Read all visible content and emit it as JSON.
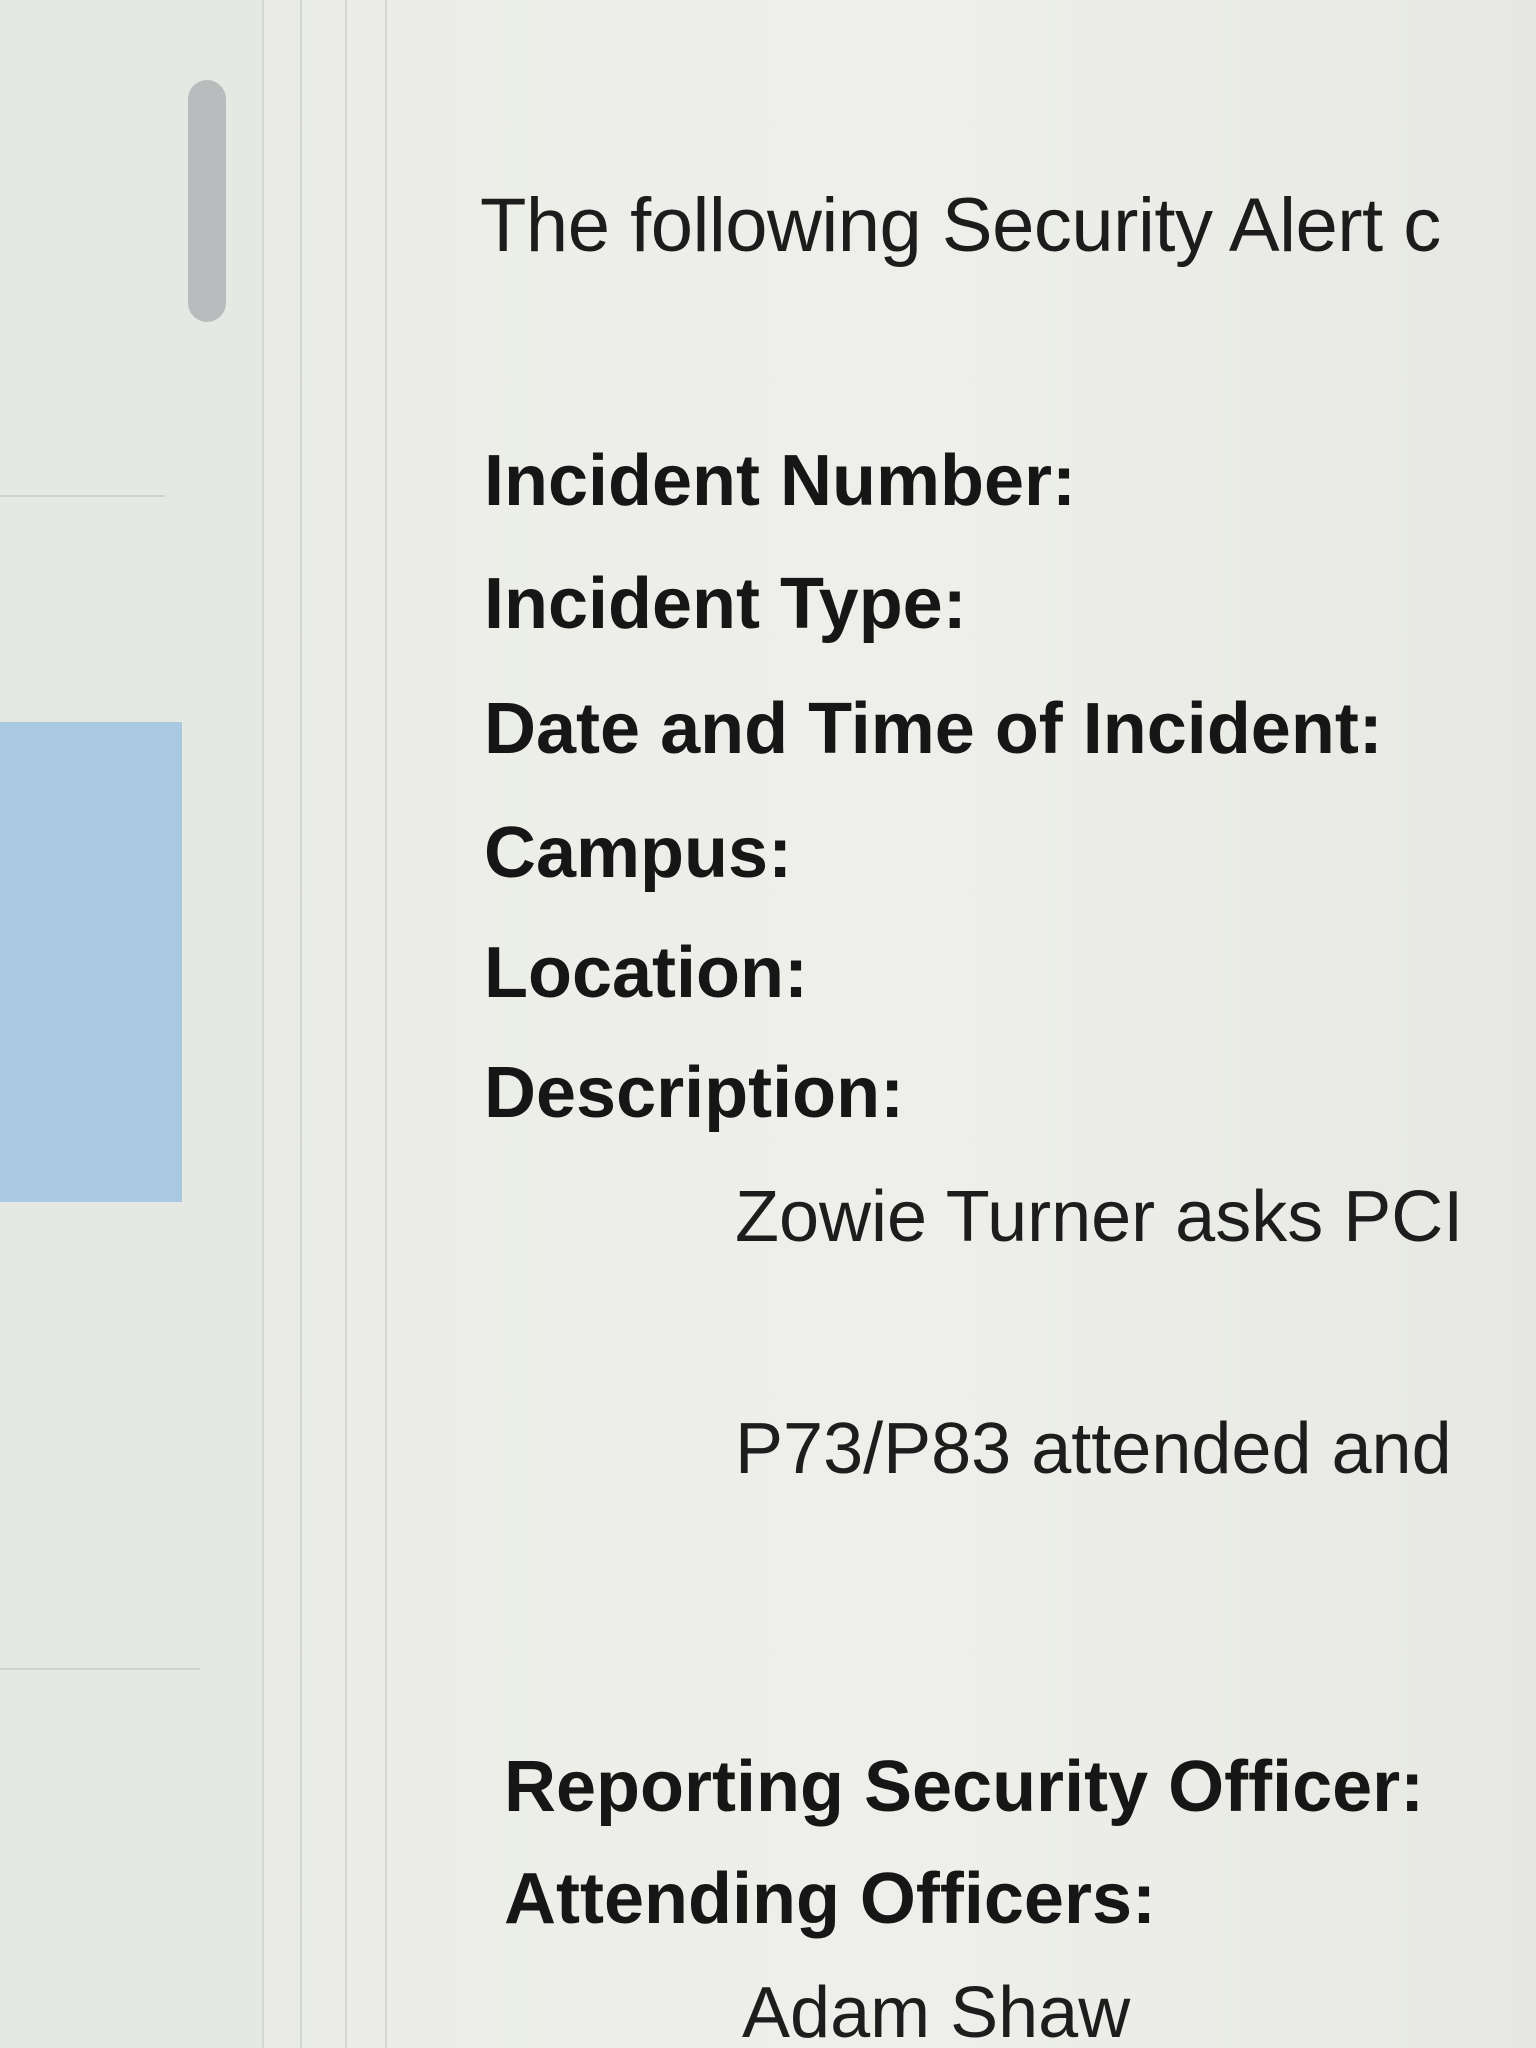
{
  "message": {
    "intro": "The following Security Alert c",
    "fields": {
      "incident_number": "Incident Number:",
      "incident_type": "Incident Type:",
      "date_time": "Date and Time of Incident:",
      "campus": "Campus:",
      "location": "Location:",
      "description": "Description:"
    },
    "description_lines": [
      "Zowie Turner asks PCI",
      "P73/P83 attended and"
    ],
    "reporting_officer_label": "Reporting Security Officer:",
    "attending_officers_label": "Attending Officers:",
    "attending_officers": [
      "Adam Shaw"
    ]
  },
  "colors": {
    "selection": "#a9c8e2",
    "scrollbar": "#b9bcbd",
    "background": "#eceee9"
  }
}
